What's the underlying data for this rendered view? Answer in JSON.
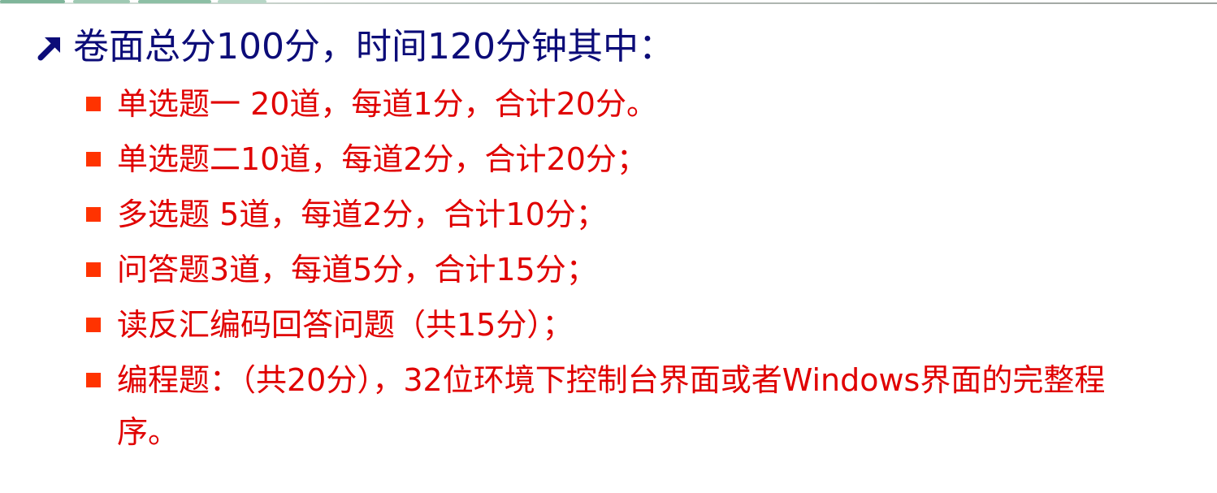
{
  "slide": {
    "main_point": "卷面总分100分，时间120分钟其中：",
    "sub_points": [
      "单选题一 20道，每道1分，合计20分。",
      "单选题二10道，每道2分，合计20分；",
      "多选题 5道，每道2分，合计10分；",
      "问答题3道，每道5分，合计15分；",
      "读反汇编码回答问题（共15分）；",
      "编程题：（共20分），32位环境下控制台界面或者Windows界面的完整程序。"
    ]
  },
  "colors": {
    "main_text": "#0c0c78",
    "sub_text": "#e00000",
    "bullet_square": "#ff3300"
  },
  "icons": {
    "main_bullet": "northeast-arrow-icon",
    "sub_bullet": "square-bullet-icon"
  }
}
